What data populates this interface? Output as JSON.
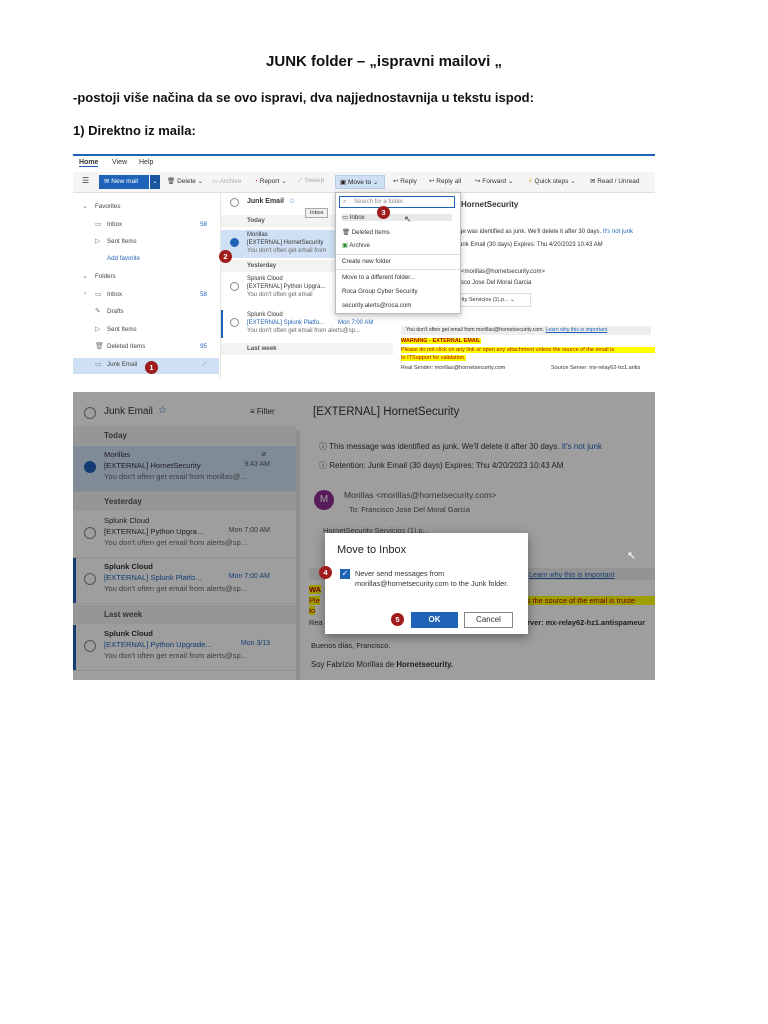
{
  "document": {
    "title": "JUNK folder – „ispravni mailovi „",
    "intro": "-postoji više načina da se ovo ispravi, dva najjednostavnija u tekstu ispod:",
    "step1": "1) Direktno iz maila:"
  },
  "shot1": {
    "tabs": [
      "Home",
      "View",
      "Help"
    ],
    "toolbar": {
      "new_mail": "New mail",
      "delete": "Delete",
      "archive": "Archive",
      "report": "Report",
      "sweep": "Sweep",
      "move_to": "Move to",
      "reply": "Reply",
      "reply_all": "Reply all",
      "forward": "Forward",
      "quick_steps": "Quick steps",
      "read_unread": "Read / Unread"
    },
    "nav": {
      "favorites": "Favorites",
      "inbox": "Inbox",
      "inbox_count": "58",
      "sent": "Sent Items",
      "add_favorite": "Add favorite",
      "folders": "Folders",
      "inbox2": "Inbox",
      "inbox2_count": "58",
      "drafts": "Drafts",
      "sent2": "Sent Items",
      "deleted": "Deleted Items",
      "deleted_count": "95",
      "junk": "Junk Email"
    },
    "list": {
      "title": "Junk Email",
      "today": "Today",
      "m1": {
        "from": "Morillas",
        "subject": "[EXTERNAL] HornetSecurity",
        "preview": "You don't often get email from"
      },
      "yesterday": "Yesterday",
      "m2": {
        "from": "Splunk Cloud",
        "subject": "[EXTERNAL] Python Upgra...",
        "preview": "You don't often get email"
      },
      "m3": {
        "from": "Splunk Cloud",
        "subject": "[EXTERNAL] Splunk Platfo...",
        "time": "Mon 7:00 AM",
        "preview": "You don't often get email from alerts@sp..."
      },
      "last_week": "Last week"
    },
    "reading": {
      "subject": "HornetSecurity",
      "junk_notice": "ge was identified as junk. We'll delete it after 30 days.",
      "not_junk": "It's not junk",
      "retention": "unk Email (30 days) Expires: Thu 4/20/2023 10:43 AM",
      "sender": "<morillas@hornetsecurity.com>",
      "to": "sco Jose Del Moral Garcia",
      "attach": "rity Servicios (1).p...",
      "banner": "You don't often get email from morillas@hornetsecurity.com.",
      "banner_link": "Learn why this is important",
      "warning_title": "WARNING - EXTERNAL EMAIL",
      "warning_body": "Please do not click on any link or open any attachment unless the source of the email is",
      "warning_body2": "to ITSupport for validation.",
      "real_sender": "Real Sender: morillas@hornetsecurity.com",
      "source_server": "Source Server: mx-relay62-hz1.antis"
    },
    "dropdown": {
      "search": "Search for a folder",
      "inbox": "Inbox",
      "deleted": "Deleted Items",
      "archive": "Archive",
      "new_folder": "Create new folder",
      "move_different": "Move to a different folder...",
      "roca": "Roca Group Cyber Security",
      "security": "security.alerts@roca.com"
    },
    "tooltip": "Inbox",
    "badges": [
      "1",
      "2",
      "3"
    ]
  },
  "shot2": {
    "list": {
      "title": "Junk Email",
      "filter": "Filter",
      "today": "Today",
      "m1": {
        "from": "Morillas",
        "subject": "[EXTERNAL] HornetSecurity",
        "time": "9:43 AM",
        "preview": "You don't often get email from morillas@..."
      },
      "yesterday": "Yesterday",
      "m2": {
        "from": "Splunk Cloud",
        "subject": "[EXTERNAL] Python Upgra...",
        "time": "Mon 7:00 AM",
        "preview": "You don't often get email from alerts@sp..."
      },
      "m3": {
        "from": "Splunk Cloud",
        "subject": "[EXTERNAL] Splunk Platfo...",
        "time": "Mon 7:00 AM",
        "preview": "You don't often get email from alerts@sp..."
      },
      "last_week": "Last week",
      "m4": {
        "from": "Splunk Cloud",
        "subject": "[EXTERNAL] Python Upgrade...",
        "time": "Mon 3/13",
        "preview": "You don't often get email from alerts@sp..."
      }
    },
    "reading": {
      "subject": "[EXTERNAL] HornetSecurity",
      "junk_notice": "This message was identified as junk. We'll delete it after 30 days.",
      "not_junk": "It's not junk",
      "retention": "Retention: Junk Email (30 days) Expires: Thu 4/20/2023 10:43 AM",
      "avatar": "M",
      "sender": "Morillas <morillas@hornetsecurity.com>",
      "to": "To:  Francisco Jose Del Moral Garcia",
      "attach": "HornetSecurity Servicios (1).p...",
      "learn": "Learn why this is important",
      "warn_frag1": "WA",
      "warn_frag2": "Ple",
      "warn_frag3": "to",
      "warn_right": "ss the source of the email is truste",
      "real": "Rea",
      "server": "erver: mx-relay62-hz1.antispameur",
      "greeting": "Buenos días, Francisco.",
      "intro_a": "Soy Fabrizio Morillas de ",
      "intro_b": "Hornetsecurity."
    },
    "dialog": {
      "title": "Move to Inbox",
      "checkbox_label": "Never send messages from morillas@hornetsecurity.com to the Junk folder.",
      "ok": "OK",
      "cancel": "Cancel"
    },
    "badges": [
      "4",
      "5"
    ]
  }
}
